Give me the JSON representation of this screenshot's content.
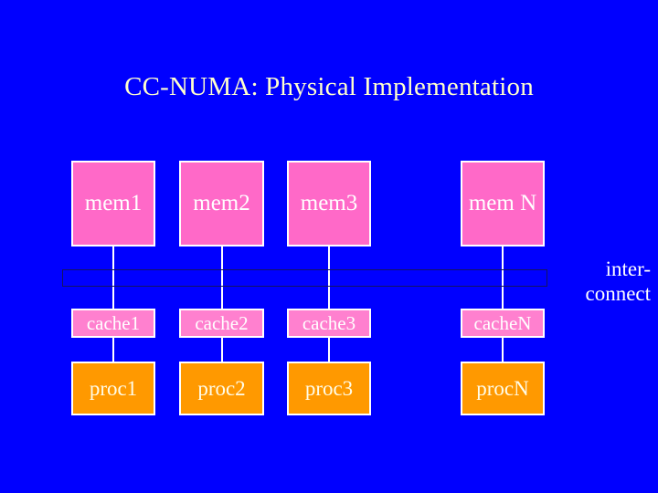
{
  "slide": {
    "title": "CC-NUMA: Physical Implementation",
    "background_color": "#0000FF",
    "title_color": "#FFFFCC"
  },
  "diagram": {
    "type": "block-diagram",
    "interconnect": {
      "label_line1": "inter-",
      "label_line2": "connect",
      "label_color": "#FFFFFF",
      "bar_border_color": "#151560"
    },
    "colors": {
      "memory_fill": "#FF69C8",
      "cache_fill": "#FF80CF",
      "processor_fill": "#FF9900",
      "box_border": "#FFFFFF",
      "memory_text": "#FFFFFF",
      "cache_text": "#FFFFFF",
      "processor_text": "#FFFCE8",
      "connector_line": "#FFFFFF"
    },
    "columns": [
      {
        "memory": "mem1",
        "cache": "cache1",
        "processor": "proc1"
      },
      {
        "memory": "mem2",
        "cache": "cache2",
        "processor": "proc2"
      },
      {
        "memory": "mem3",
        "cache": "cache3",
        "processor": "proc3"
      },
      {
        "memory": "mem N",
        "cache": "cacheN",
        "processor": "procN"
      }
    ]
  }
}
